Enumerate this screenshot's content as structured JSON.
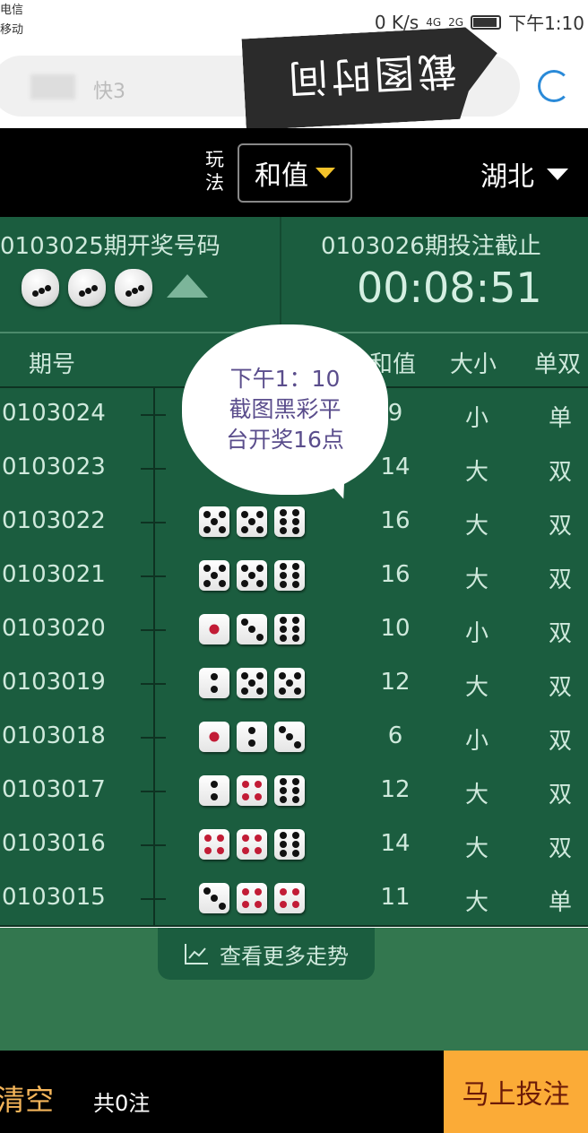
{
  "status_bar": {
    "carrier1": "电信",
    "carrier2": "移动",
    "speed": "0 K/s",
    "net1": "4G",
    "net2": "2G",
    "time": "下午1:10"
  },
  "search": {
    "title": "快3"
  },
  "sticker": {
    "text": "截图时间"
  },
  "header": {
    "play_label": "玩法",
    "play_value": "和值",
    "region": "湖北"
  },
  "last_draw": {
    "label": "0103025期开奖号码",
    "dice": [
      3,
      3,
      3
    ]
  },
  "next_draw": {
    "label": "0103026期投注截止",
    "countdown": "00:08:51"
  },
  "table": {
    "headers": {
      "period": "期号",
      "sum": "和值",
      "size": "大小",
      "parity": "单双"
    },
    "rows": [
      {
        "period": "0103024",
        "dice": [],
        "sum": "9",
        "size": "小",
        "parity": "单"
      },
      {
        "period": "0103023",
        "dice": [],
        "sum": "14",
        "size": "大",
        "parity": "双"
      },
      {
        "period": "0103022",
        "dice": [
          5,
          5,
          6
        ],
        "sum": "16",
        "size": "大",
        "parity": "双"
      },
      {
        "period": "0103021",
        "dice": [
          5,
          5,
          6
        ],
        "sum": "16",
        "size": "大",
        "parity": "双"
      },
      {
        "period": "0103020",
        "dice": [
          1,
          3,
          6
        ],
        "sum": "10",
        "size": "小",
        "parity": "双"
      },
      {
        "period": "0103019",
        "dice": [
          2,
          5,
          5
        ],
        "sum": "12",
        "size": "大",
        "parity": "双"
      },
      {
        "period": "0103018",
        "dice": [
          1,
          2,
          3
        ],
        "sum": "6",
        "size": "小",
        "parity": "双"
      },
      {
        "period": "0103017",
        "dice": [
          2,
          4,
          6
        ],
        "sum": "12",
        "size": "大",
        "parity": "双"
      },
      {
        "period": "0103016",
        "dice": [
          4,
          4,
          6
        ],
        "sum": "14",
        "size": "大",
        "parity": "双"
      },
      {
        "period": "0103015",
        "dice": [
          3,
          4,
          4
        ],
        "sum": "11",
        "size": "大",
        "parity": "单"
      }
    ]
  },
  "annotation": {
    "line1": "下午1：10",
    "line2": "截图黑彩平",
    "line3": "台开奖16点"
  },
  "more_trends": {
    "icon": "line-chart-icon",
    "label": "查看更多走势"
  },
  "footer": {
    "clear": "清空",
    "count": "共0注",
    "bet": "马上投注"
  },
  "colors": {
    "table_bg": "#1b5d3f",
    "bet_button": "#fbab37",
    "accent_yellow": "#f3c22a",
    "red_pip": "#c21c36"
  }
}
